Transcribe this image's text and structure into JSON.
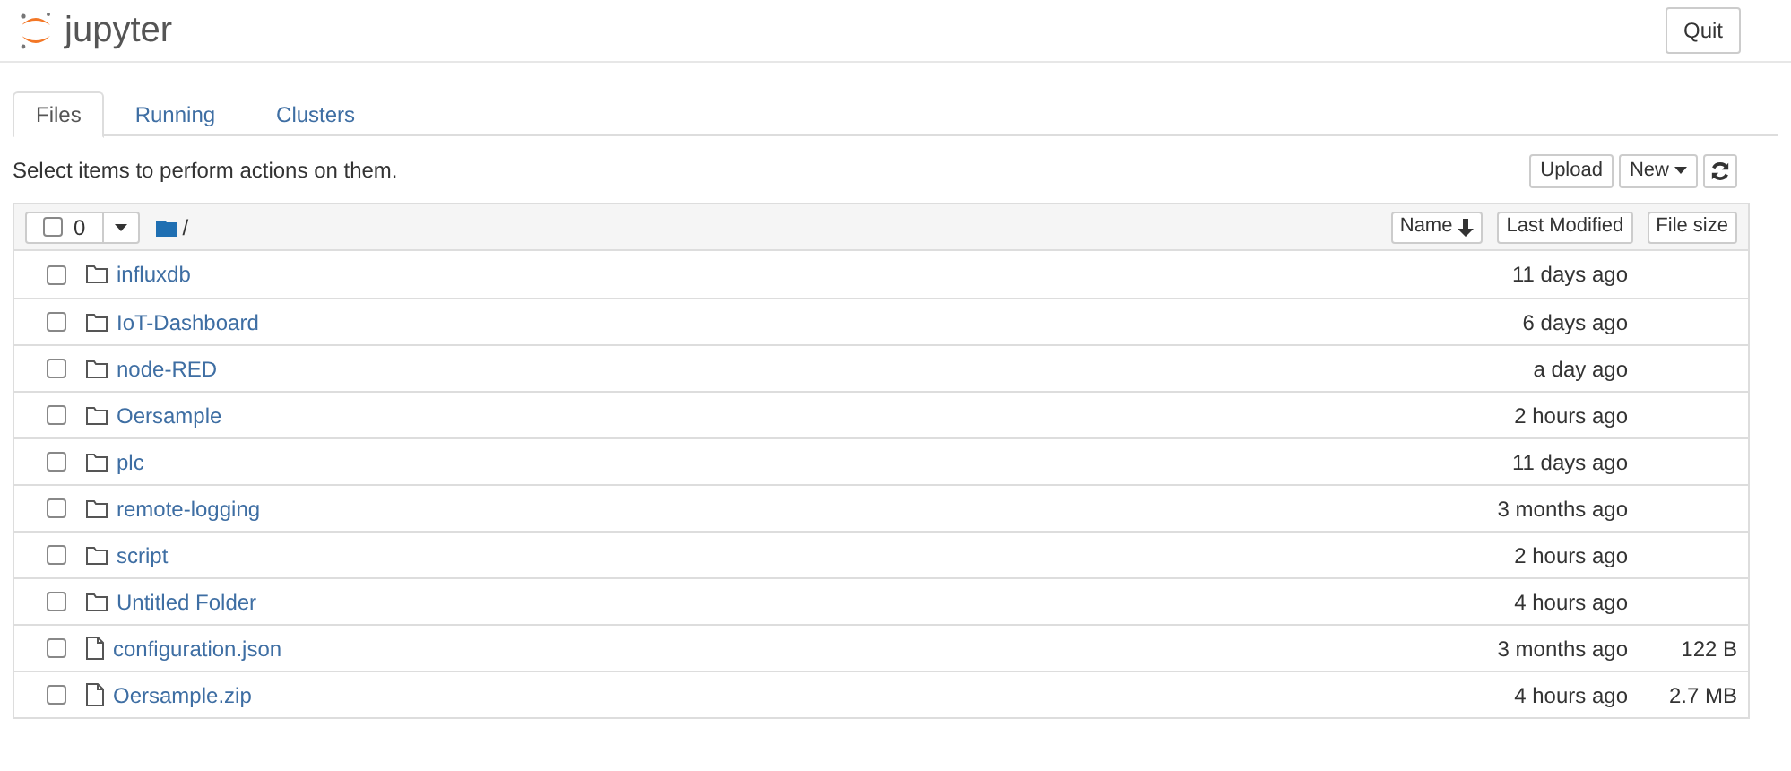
{
  "header": {
    "logo_text": "jupyter",
    "quit_button": "Quit"
  },
  "tabs": [
    {
      "label": "Files",
      "selected": true
    },
    {
      "label": "Running",
      "selected": false
    },
    {
      "label": "Clusters",
      "selected": false
    }
  ],
  "toolbar": {
    "hint": "Select items to perform actions on them.",
    "upload_button": "Upload",
    "new_button": "New"
  },
  "list_header": {
    "checked": false,
    "selected_count": "0",
    "path": "/",
    "columns": [
      "Name",
      "Last Modified",
      "File size"
    ]
  },
  "rows": [
    {
      "kind": "folder",
      "name": "influxdb",
      "modified": "11 days ago",
      "checked": false
    },
    {
      "kind": "folder",
      "name": "IoT-Dashboard",
      "modified": "6 days ago",
      "checked": false
    },
    {
      "kind": "folder",
      "name": "node-RED",
      "modified": "a day ago",
      "checked": false
    },
    {
      "kind": "folder",
      "name": "Oersample",
      "modified": "2 hours ago",
      "checked": false
    },
    {
      "kind": "folder",
      "name": "plc",
      "modified": "11 days ago",
      "checked": false
    },
    {
      "kind": "folder",
      "name": "remote-logging",
      "modified": "3 months ago",
      "checked": false
    },
    {
      "kind": "folder",
      "name": "script",
      "modified": "2 hours ago",
      "checked": false
    },
    {
      "kind": "folder",
      "name": "Untitled Folder",
      "modified": "4 hours ago",
      "checked": false
    },
    {
      "kind": "file",
      "name": "configuration.json",
      "modified": "3 months ago",
      "size": "122 B",
      "checked": false
    },
    {
      "kind": "file",
      "name": "Oersample.zip",
      "modified": "4 hours ago",
      "size": "2.7 MB",
      "checked": false
    }
  ]
}
